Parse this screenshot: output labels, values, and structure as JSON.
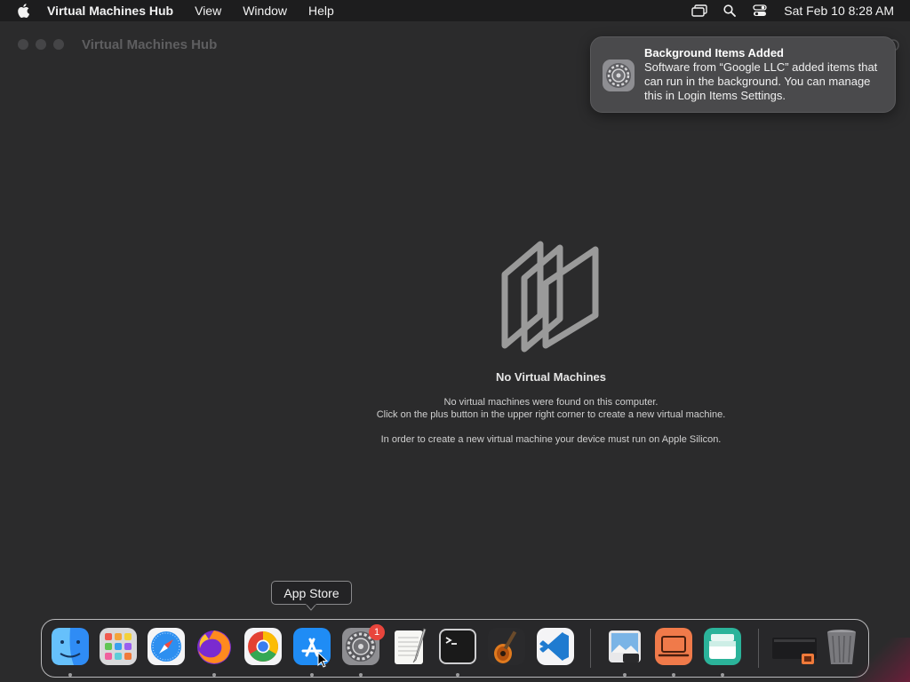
{
  "menubar": {
    "app_name": "Virtual Machines Hub",
    "items": [
      "View",
      "Window",
      "Help"
    ],
    "clock": "Sat Feb 10  8:28 AM",
    "icons": [
      "apple-icon",
      "screen-mirroring-icon",
      "spotlight-search-icon",
      "control-center-icon"
    ]
  },
  "window": {
    "title": "Virtual Machines Hub"
  },
  "empty_state": {
    "title": "No Virtual Machines",
    "line1": "No virtual machines were found on this computer.",
    "line2": "Click on the plus button in the upper right corner to create a new virtual machine.",
    "line3": "In order to create a new virtual machine your device must run on Apple Silicon."
  },
  "notification": {
    "title": "Background Items Added",
    "text": "Software from “Google LLC” added items that can run in the background. You can manage this in Login Items Settings.",
    "icon": "system-settings-icon"
  },
  "tooltip": {
    "label": "App Store"
  },
  "dock": {
    "items": [
      {
        "name": "Finder",
        "running": true
      },
      {
        "name": "Launchpad",
        "running": false
      },
      {
        "name": "Safari",
        "running": false
      },
      {
        "name": "Firefox",
        "running": true
      },
      {
        "name": "Google Chrome",
        "running": false
      },
      {
        "name": "App Store",
        "running": true
      },
      {
        "name": "System Settings",
        "running": true,
        "badge": "1"
      },
      {
        "name": "TextEdit",
        "running": false
      },
      {
        "name": "Terminal",
        "running": true
      },
      {
        "name": "GarageBand",
        "running": false
      },
      {
        "name": "Visual Studio Code",
        "running": false
      },
      {
        "name": "Preview",
        "running": true
      },
      {
        "name": "Screen Sharing",
        "running": true
      },
      {
        "name": "Virtual Machines Hub",
        "running": true
      },
      {
        "name": "Downloads",
        "running": false
      },
      {
        "name": "Trash",
        "running": false
      }
    ]
  },
  "colors": {
    "window_bg": "#2b2b2c",
    "menubar_bg": "#1d1d1e",
    "badge": "#e8453c"
  }
}
